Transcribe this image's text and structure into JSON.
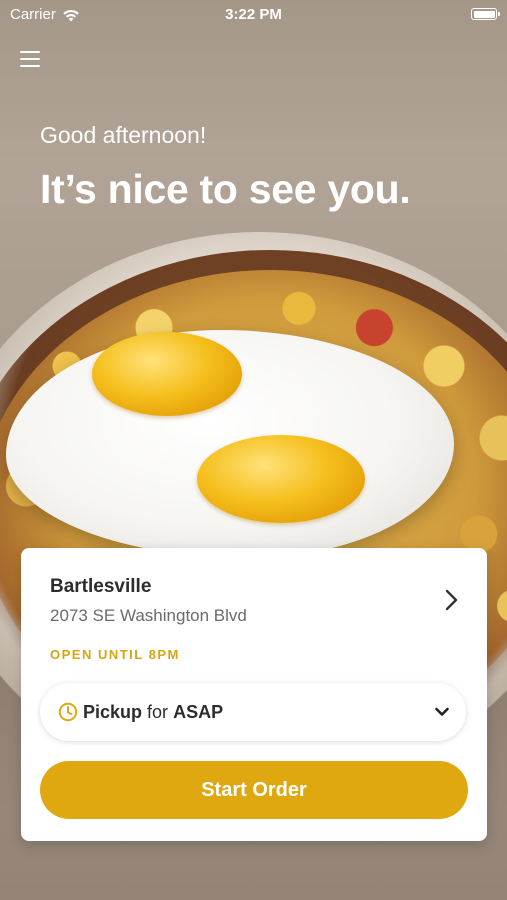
{
  "status_bar": {
    "carrier": "Carrier",
    "time": "3:22 PM"
  },
  "header": {
    "greeting": "Good afternoon!",
    "headline": "It’s nice to see you."
  },
  "store": {
    "name": "Bartlesville",
    "address": "2073 SE Washington Blvd",
    "hours": "OPEN UNTIL 8PM"
  },
  "order_mode": {
    "mode": "Pickup",
    "connector": "for",
    "time": "ASAP"
  },
  "actions": {
    "start_order": "Start Order"
  },
  "colors": {
    "accent": "#dfa810",
    "hours_text": "#d9a414",
    "card_bg": "#ffffff"
  },
  "icons": {
    "menu": "hamburger-menu-icon",
    "store_chevron": "chevron-right-icon",
    "order_time": "clock-icon",
    "dropdown": "chevron-down-icon",
    "signal": "wifi-icon",
    "battery": "battery-icon"
  }
}
